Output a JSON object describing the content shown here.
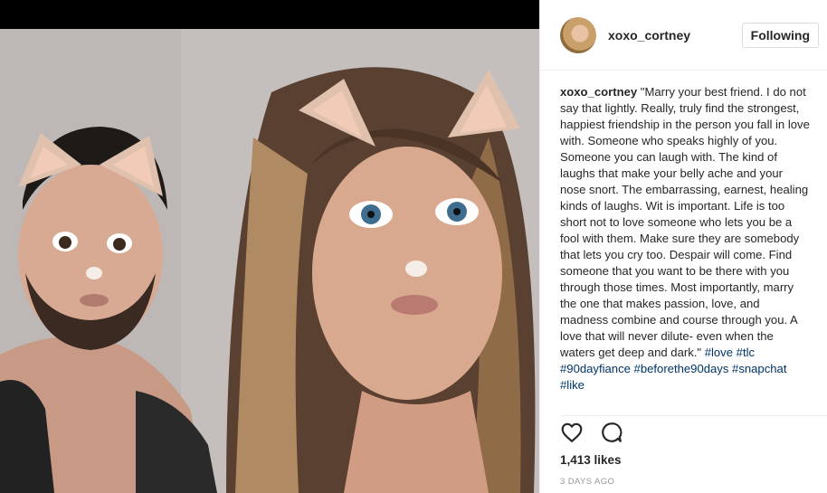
{
  "post": {
    "username": "xoxo_cortney",
    "follow_label": "Following",
    "caption_user": "xoxo_cortney",
    "caption_text": " \"Marry your best friend. I do not say that lightly. Really, truly find the strongest, happiest friendship in the person you fall in love with. Someone who speaks highly of you. Someone you can laugh with. The kind of laughs that make your belly ache and your nose snort. The embarrassing, earnest, healing kinds of laughs. Wit is important. Life is too short not to love someone who lets you be a fool with them. Make sure they are somebody that lets you cry too. Despair will come. Find someone that you want to be there with you through those times. Most importantly, marry the one that makes passion, love, and madness combine and course through you. A love that will never dilute- even when the waters get deep and dark.\" ",
    "hashtags": [
      "#love",
      "#tlc",
      "#90dayfiance",
      "#beforethe90days",
      "#snapchat",
      "#like"
    ],
    "likes": "1,413 likes",
    "date": "3 DAYS AGO",
    "icons": {
      "like": "heart-icon",
      "comment": "comment-icon"
    }
  },
  "colors": {
    "link": "#003569",
    "text": "#262626",
    "muted": "#999999",
    "border": "#dbdbdb"
  }
}
